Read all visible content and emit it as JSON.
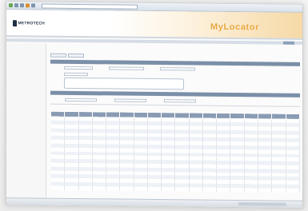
{
  "browser": {
    "address": ""
  },
  "header": {
    "brand": "METROTECH",
    "product": "MyLocator"
  },
  "sidebar": {
    "items": [
      "",
      "",
      "",
      "",
      "",
      "",
      "",
      "",
      "",
      "",
      "",
      "",
      ""
    ]
  },
  "main": {
    "title": "",
    "subtitle": "",
    "section_label": "",
    "notes": ""
  },
  "table": {
    "caption": "",
    "columns": [
      "",
      "",
      "",
      "",
      "",
      "",
      "",
      "",
      "",
      "",
      "",
      "",
      "",
      "",
      "",
      "",
      "",
      ""
    ],
    "row_count": 19
  },
  "status": {
    "text": ""
  },
  "colors": {
    "accent": "#e9a43a",
    "header_bar": "#7b8fa8",
    "table_header": "#8a9cb4"
  }
}
